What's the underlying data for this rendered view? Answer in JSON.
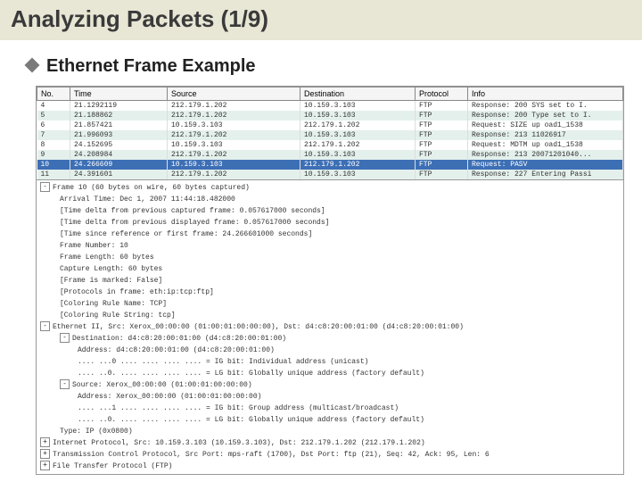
{
  "title": "Analyzing Packets (1/9)",
  "subheading": "Ethernet Frame Example",
  "columns": {
    "no": "No.",
    "time": "Time",
    "src": "Source",
    "dst": "Destination",
    "proto": "Protocol",
    "info": "Info"
  },
  "packets": [
    {
      "no": "4",
      "time": "21.1292119",
      "src": "212.179.1.202",
      "dst": "10.159.3.103",
      "proto": "FTP",
      "info": "Response: 200 SYS set to I."
    },
    {
      "no": "5",
      "time": "21.188862",
      "src": "212.179.1.202",
      "dst": "10.159.3.103",
      "proto": "FTP",
      "info": "Response: 200 Type set to I."
    },
    {
      "no": "6",
      "time": "21.857421",
      "src": "10.159.3.103",
      "dst": "212.179.1.202",
      "proto": "FTP",
      "info": "Request: SIZE up oad1_1538"
    },
    {
      "no": "7",
      "time": "21.996093",
      "src": "212.179.1.202",
      "dst": "10.159.3.103",
      "proto": "FTP",
      "info": "Response: 213 11026917"
    },
    {
      "no": "8",
      "time": "24.152695",
      "src": "10.159.3.103",
      "dst": "212.179.1.202",
      "proto": "FTP",
      "info": "Request: MDTM up oad1_1538"
    },
    {
      "no": "9",
      "time": "24.208984",
      "src": "212.179.1.202",
      "dst": "10.159.3.103",
      "proto": "FTP",
      "info": "Response: 213 20071201040..."
    },
    {
      "no": "10",
      "time": "24.266609",
      "src": "10.159.3.103",
      "dst": "212.179.1.202",
      "proto": "FTP",
      "info": "Request: PASV"
    },
    {
      "no": "11",
      "time": "24.391601",
      "src": "212.179.1.202",
      "dst": "10.159.3.103",
      "proto": "FTP",
      "info": "Response: 227 Entering Passi"
    }
  ],
  "details": {
    "frame_header": "Frame 10 (60 bytes on wire, 60 bytes captured)",
    "frame": [
      "Arrival Time: Dec 1, 2007 11:44:18.482000",
      "[Time delta from previous captured frame: 0.057617000 seconds]",
      "[Time delta from previous displayed frame: 0.057617000 seconds]",
      "[Time since reference or first frame: 24.266601000 seconds]",
      "Frame Number: 10",
      "Frame Length: 60 bytes",
      "Capture Length: 60 bytes",
      "[Frame is marked: False]",
      "[Protocols in frame: eth:ip:tcp:ftp]",
      "[Coloring Rule Name: TCP]",
      "[Coloring Rule String: tcp]"
    ],
    "eth_header": "Ethernet II, Src: Xerox_00:00:00 (01:00:01:00:00:00), Dst: d4:c8:20:00:01:00 (d4:c8:20:00:01:00)",
    "eth_dest_header": "Destination: d4:c8:20:00:01:00 (d4:c8:20:00:01:00)",
    "eth_dest": [
      "Address: d4:c8:20:00:01:00 (d4:c8:20:00:01:00)",
      ".... ...0 .... .... .... .... = IG bit: Individual address (unicast)",
      ".... ..0. .... .... .... .... = LG bit: Globally unique address (factory default)"
    ],
    "eth_src_header": "Source: Xerox_00:00:00 (01:00:01:00:00:00)",
    "eth_src": [
      "Address: Xerox_00:00:00 (01:00:01:00:00:00)",
      ".... ...1 .... .... .... .... = IG bit: Group address (multicast/broadcast)",
      ".... ..0. .... .... .... .... = LG bit: Globally unique address (factory default)"
    ],
    "eth_type": "Type: IP (0x0800)",
    "ip_header": "Internet Protocol, Src: 10.159.3.103 (10.159.3.103), Dst: 212.179.1.202 (212.179.1.202)",
    "tcp_header": "Transmission Control Protocol, Src Port: mps-raft (1700), Dst Port: ftp (21), Seq: 42, Ack: 95, Len: 6",
    "ftp_header": "File Transfer Protocol (FTP)"
  }
}
